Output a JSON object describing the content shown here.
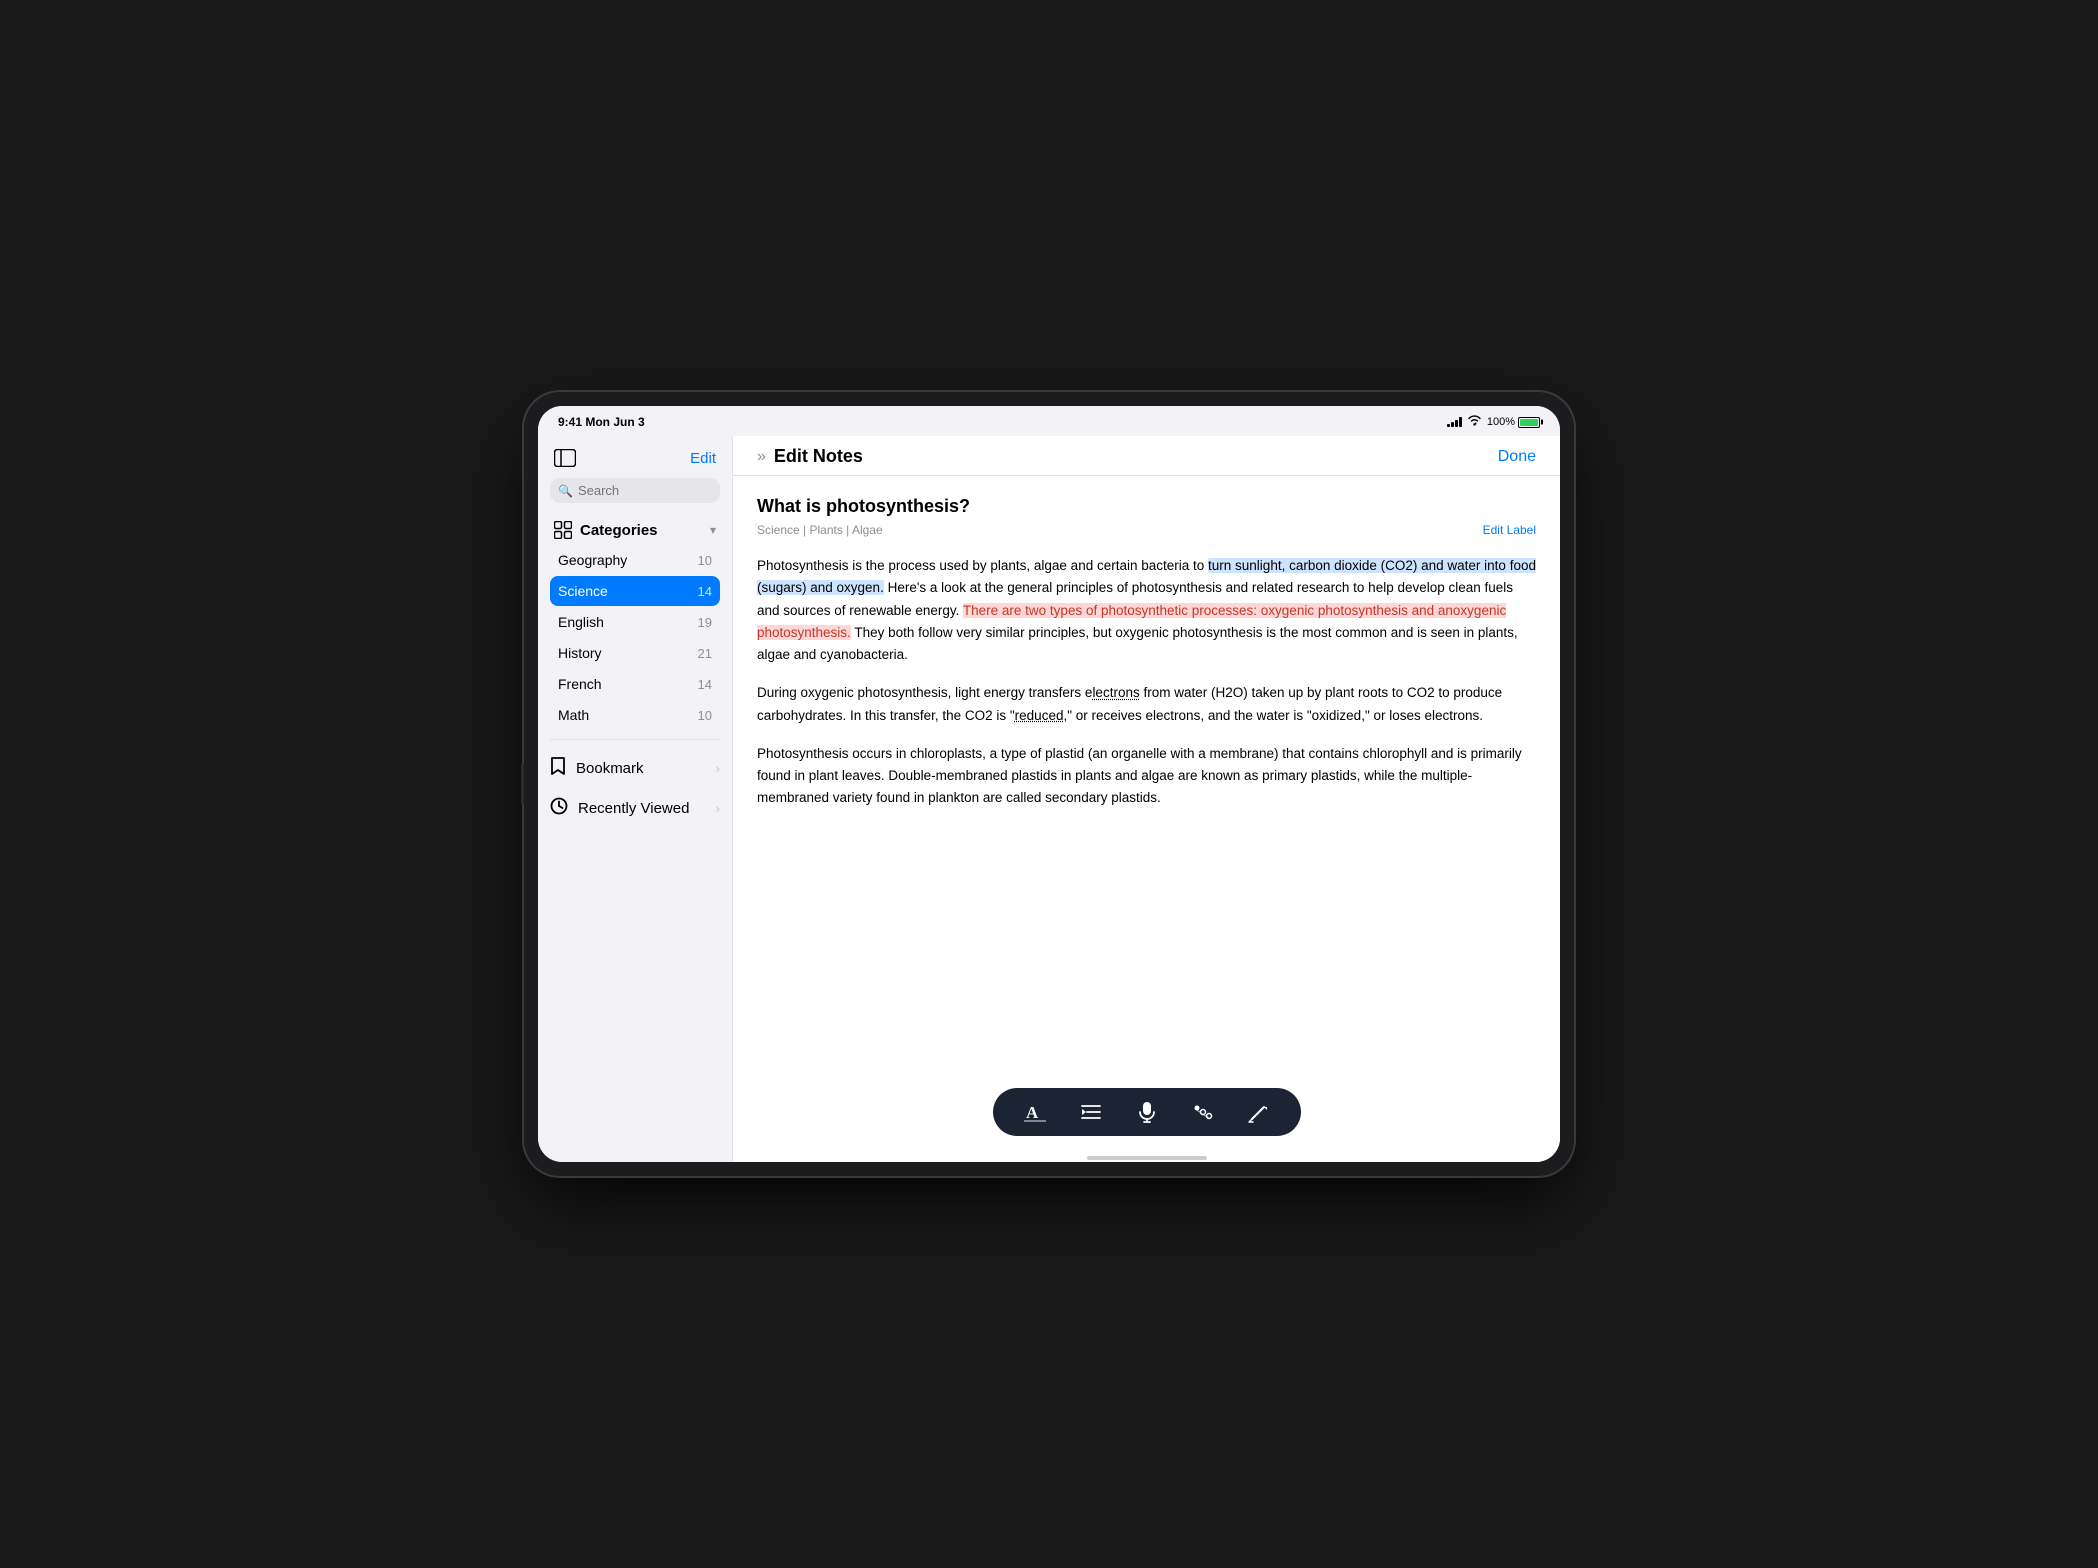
{
  "device": {
    "status_bar": {
      "time": "9:41 Mon Jun 3",
      "battery_percent": "100%"
    }
  },
  "sidebar": {
    "edit_label": "Edit",
    "search_placeholder": "Search",
    "categories_label": "Categories",
    "items": [
      {
        "label": "Geography",
        "count": "10",
        "active": false
      },
      {
        "label": "Science",
        "count": "14",
        "active": true
      },
      {
        "label": "English",
        "count": "19",
        "active": false
      },
      {
        "label": "History",
        "count": "21",
        "active": false
      },
      {
        "label": "French",
        "count": "14",
        "active": false
      },
      {
        "label": "Math",
        "count": "10",
        "active": false
      }
    ],
    "bookmark_label": "Bookmark",
    "recently_viewed_label": "Recently Viewed"
  },
  "note": {
    "header_title": "Edit Notes",
    "done_label": "Done",
    "heading": "What is photosynthesis?",
    "tags": "Science | Plants | Algae",
    "edit_label_link": "Edit Label",
    "body_p1_pre": "Photosynthesis is the process used by plants, algae and certain bacteria to ",
    "body_p1_highlight": "turn sunlight, carbon dioxide (CO2) and water into food (sugars) and oxygen.",
    "body_p1_post": " Here's a look at the general principles of photosynthesis and related research to help develop clean fuels and sources of renewable energy. ",
    "body_p1_pink": "There are two types of photosynthetic processes: oxygenic photosynthesis and anoxygenic photosynthesis.",
    "body_p1_end": " They both follow very similar principles, but oxygenic photosynthesis is the most common and is seen in plants, algae and cyanobacteria.",
    "body_p2": "During oxygenic photosynthesis, light energy transfers electrons from water (H2O) taken up by plant roots to CO2 to produce carbohydrates. In this transfer, the CO2 is \"reduced,\" or receives electrons, and the water is \"oxidized,\" or loses electrons.",
    "body_p3": "Photosynthesis occurs in chloroplasts, a type of plastid (an organelle with a membrane) that contains chlorophyll and is primarily found in plant leaves. Double-membraned plastids in plants and algae are known as primary plastids, while the multiple-membraned variety found in plankton are called secondary plastids."
  },
  "toolbar": {
    "buttons": [
      {
        "icon": "A",
        "label": "font-button"
      },
      {
        "icon": "⇥",
        "label": "indent-button"
      },
      {
        "icon": "🎤",
        "label": "mic-button"
      },
      {
        "icon": "⬤",
        "label": "bullet-button"
      },
      {
        "icon": "✏️",
        "label": "markup-button"
      }
    ]
  }
}
